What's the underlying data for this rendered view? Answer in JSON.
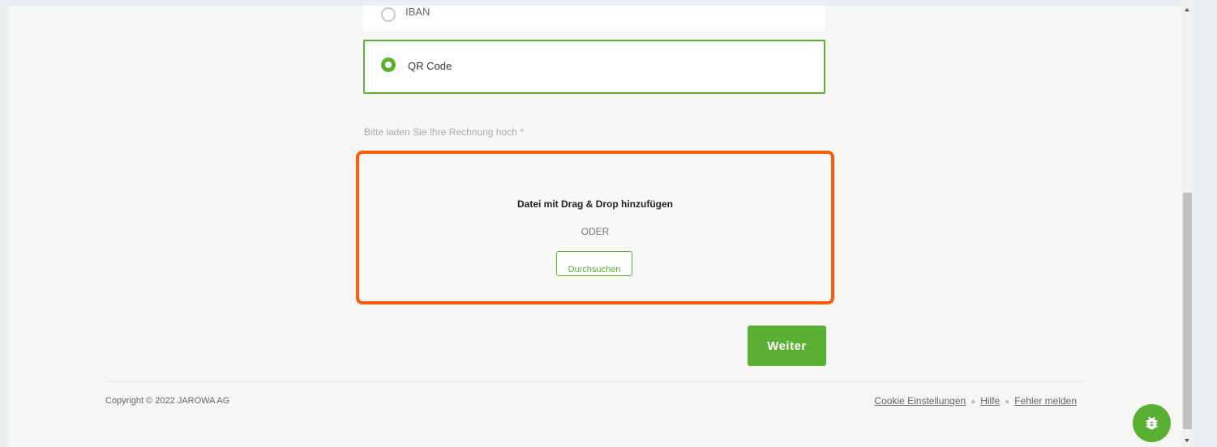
{
  "payment_options": {
    "iban_label": "IBAN",
    "qr_label": "QR Code",
    "selected": "QR Code"
  },
  "upload": {
    "label": "Bitte laden Sie Ihre Rechnung hoch *",
    "drop_title": "Datei mit Drag & Drop hinzufügen",
    "or_text": "ODER",
    "browse_label": "Durchsuchen"
  },
  "actions": {
    "next_label": "Weiter"
  },
  "footer": {
    "copyright": "Copyright © 2022 JAROWA AG",
    "links": {
      "cookie": "Cookie Einstellungen",
      "help": "Hilfe",
      "report": "Fehler melden"
    }
  },
  "colors": {
    "accent": "#5ab033",
    "highlight": "#fb5c0c"
  },
  "icons": {
    "bug": "bug-icon"
  }
}
